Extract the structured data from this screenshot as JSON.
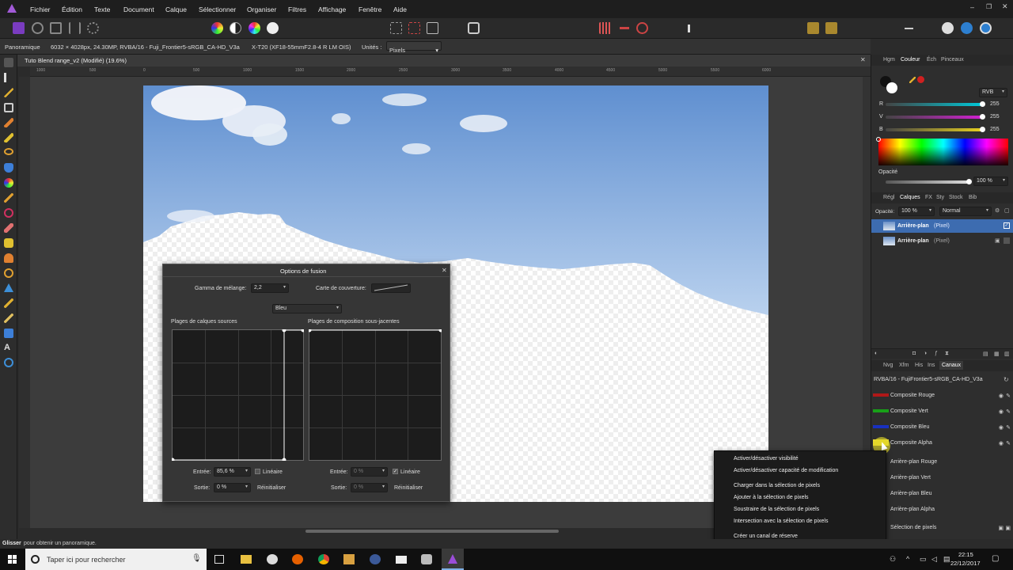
{
  "menubar": {
    "items": [
      "Fichier",
      "Édition",
      "Texte",
      "Document",
      "Calque",
      "Sélectionner",
      "Organiser",
      "Filtres",
      "Affichage",
      "Fenêtre",
      "Aide"
    ]
  },
  "context_toolbar": {
    "tool": "Panoramique",
    "doc_info": "6032 × 4028px, 24.30MP, RVBA/16 - Fuji_Frontier5-sRGB_CA-HD_V3a",
    "lens": "X-T20 (XF18-55mmF2.8-4 R LM OIS)",
    "units_label": "Unités :",
    "units_value": "Pixels"
  },
  "document": {
    "tab_title": "Tuto Blend range_v2 (Modifié) (19.6%)",
    "ruler_ticks": [
      "1000",
      "500",
      "0",
      "500",
      "1000",
      "1500",
      "2000",
      "2500",
      "3000",
      "3500",
      "4000",
      "4500",
      "5000",
      "5500",
      "6000"
    ]
  },
  "color_panel": {
    "tabs": [
      "Hgm",
      "Couleur",
      "Éch",
      "Pinceaux"
    ],
    "selected_tab": "Couleur",
    "model": "RVB",
    "channels": [
      {
        "letter": "R",
        "value": "255",
        "color": "#00c8d8"
      },
      {
        "letter": "V",
        "value": "255",
        "color": "#d020d0"
      },
      {
        "letter": "B",
        "value": "255",
        "color": "#e8d020"
      }
    ],
    "opacity_label": "Opacité",
    "opacity_value": "100 %"
  },
  "layers_panel": {
    "tabs": [
      "Régl",
      "Calques",
      "FX",
      "Sty",
      "Stock",
      "Bib"
    ],
    "selected_tab": "Calques",
    "opacity_label": "Opacité:",
    "opacity_value": "100 %",
    "blend_mode": "Normal",
    "layers": [
      {
        "name": "Arrière-plan",
        "type": "(Pixel)",
        "selected": true
      },
      {
        "name": "Arrière-plan",
        "type": "(Pixel)",
        "selected": false
      }
    ]
  },
  "channels_panel": {
    "tabs": [
      "Nvg",
      "Xfm",
      "His",
      "Ins",
      "Canaux"
    ],
    "selected_tab": "Canaux",
    "profile": "RVBA/16 - FujiFrontier5-sRGB_CA-HD_V3a",
    "composites": [
      {
        "label": "Composite Rouge",
        "color": "#b01818"
      },
      {
        "label": "Composite Vert",
        "color": "#18a018"
      },
      {
        "label": "Composite Bleu",
        "color": "#1830c0"
      },
      {
        "label": "Composite Alpha",
        "color": "#e8d830"
      }
    ],
    "layer_channels": [
      "Arrière-plan Rouge",
      "Arrière-plan Vert",
      "Arrière-plan Bleu",
      "Arrière-plan Alpha"
    ],
    "pixel_selection": "Sélection de pixels"
  },
  "context_menu": {
    "items": [
      "Activer/désactiver visibilité",
      "Activer/désactiver capacité de modification",
      "Charger dans la sélection de pixels",
      "Ajouter à la sélection de pixels",
      "Soustraire de la sélection de pixels",
      "Intersection avec la sélection de pixels",
      "Créer un canal de réserve"
    ]
  },
  "dialog": {
    "title": "Options de fusion",
    "gamma_label": "Gamma de mélange:",
    "gamma_value": "2,2",
    "coverage_label": "Carte de couverture:",
    "channel": "Bleu",
    "source_title": "Plages de calques sources",
    "comp_title": "Plages de composition sous-jacentes",
    "left": {
      "input_label": "Entrée:",
      "input_value": "85,6 %",
      "linear_label": "Linéaire",
      "linear_checked": false,
      "output_label": "Sortie:",
      "output_value": "0 %",
      "reset_label": "Réinitialiser"
    },
    "right": {
      "input_label": "Entrée:",
      "input_value": "0 %",
      "linear_label": "Linéaire",
      "linear_checked": true,
      "output_label": "Sortie:",
      "output_value": "0 %",
      "reset_label": "Réinitialiser"
    }
  },
  "statusbar": {
    "bold": "Glisser",
    "text": "pour obtenir un panoramique."
  },
  "taskbar": {
    "search_placeholder": "Taper ici pour rechercher",
    "time": "22:15",
    "date": "22/12/2017"
  }
}
